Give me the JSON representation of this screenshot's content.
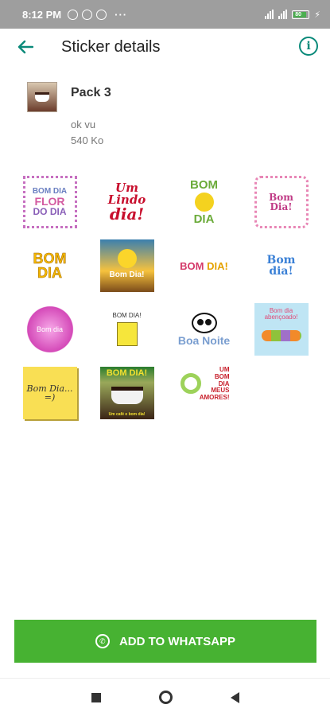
{
  "status_bar": {
    "time": "8:12 PM",
    "dots": "···",
    "battery": "80"
  },
  "app_bar": {
    "title": "Sticker details",
    "back_icon": "arrow-left-icon",
    "info_icon": "info-icon",
    "info_glyph": "i",
    "accent_color": "#0a8a7a"
  },
  "pack": {
    "name": "Pack 3",
    "publisher": "ok vu",
    "size": "540 Ko"
  },
  "stickers": {
    "s1": [
      "BOM DIA",
      "FLOR",
      "DO DIA"
    ],
    "s2": [
      "Um",
      "Lindo",
      "dia!"
    ],
    "s3": [
      "BOM",
      "DIA"
    ],
    "s4": "Bom Dia!",
    "s5": [
      "BOM",
      "DIA"
    ],
    "s6": "Bom Dia!",
    "s7": [
      "BOM ",
      "DIA!"
    ],
    "s8": "Bom dia!",
    "s9": "Bom dia",
    "s10": "BOM DIA!",
    "s11": "Boa Noite",
    "s12": "Bom dia abençoado!",
    "s13": [
      "Bom Dia...",
      "=)"
    ],
    "s14": [
      "BOM DIA!",
      "Um café e bom dia!"
    ],
    "s15": [
      "UM",
      "BOM",
      "DIA",
      "MEUS",
      "AMORES!"
    ]
  },
  "add_button": {
    "label": "ADD TO WHATSAPP",
    "icon": "whatsapp-icon",
    "color": "#47b232"
  },
  "nav_bar": {
    "recents_icon": "square-icon",
    "home_icon": "circle-icon",
    "back_icon": "triangle-back-icon"
  }
}
